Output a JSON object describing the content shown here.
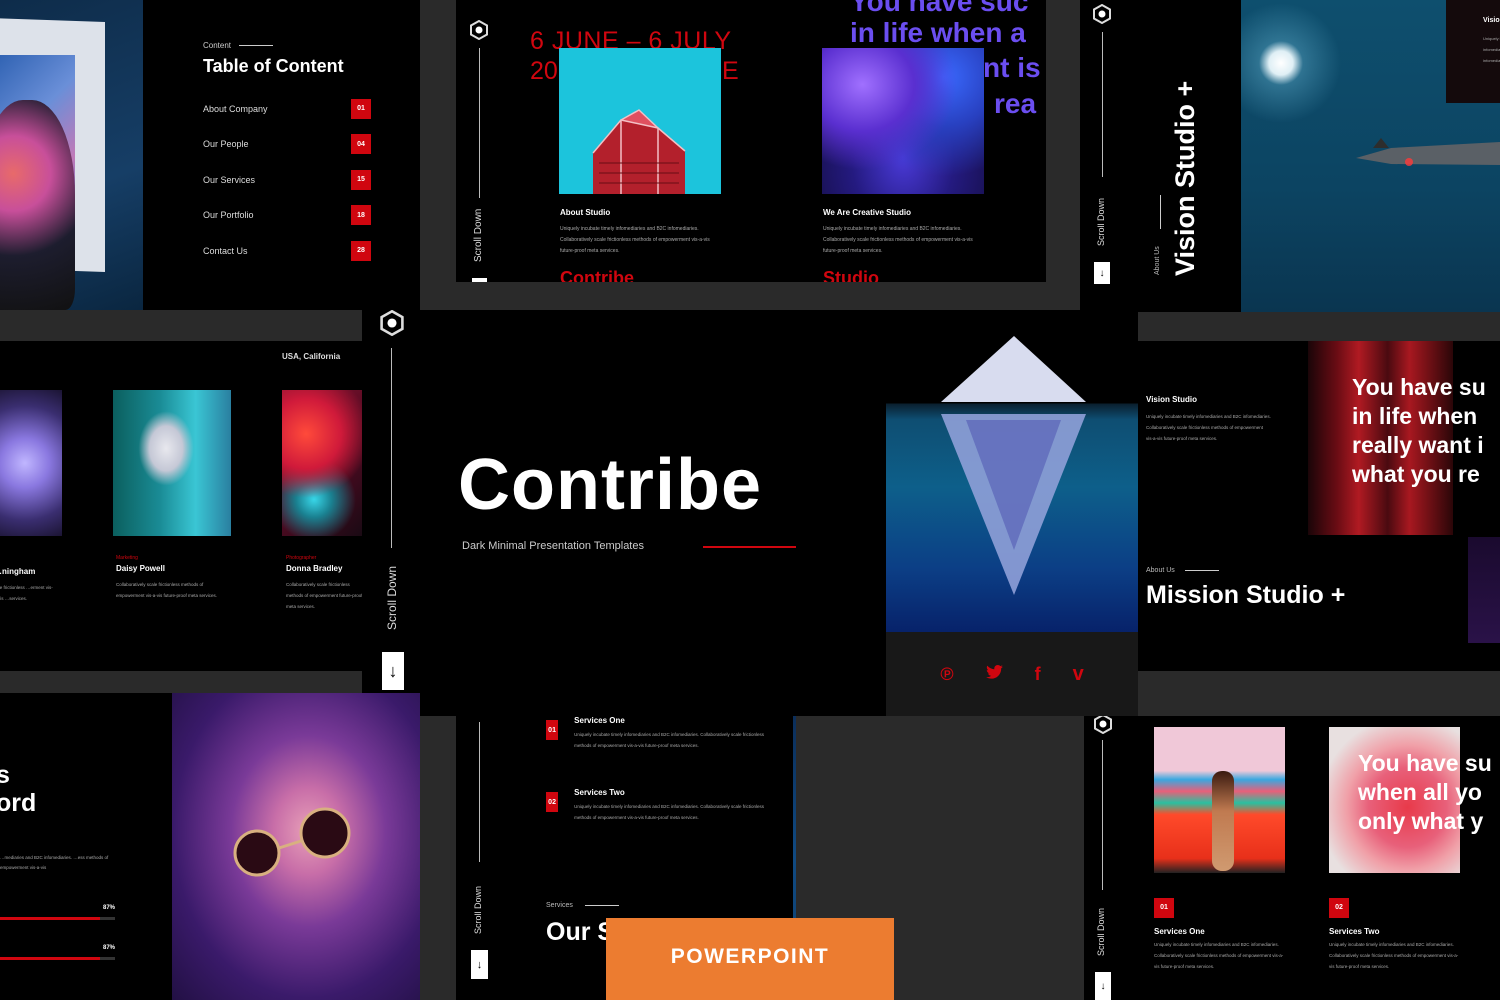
{
  "colors": {
    "background": "#2a2a2a",
    "slide_bg": "#000000",
    "accent_red": "#d0060f",
    "badge_orange": "#ec7c30",
    "purple_text": "#6b4ef0"
  },
  "slides": {
    "portrait_top_left": {
      "image": "woman-face-painted-portrait"
    },
    "table_of_content": {
      "eyebrow": "Content",
      "title": "Table of Content",
      "items": [
        {
          "label": "About Company",
          "page": "01"
        },
        {
          "label": "Our People",
          "page": "04"
        },
        {
          "label": "Our Services",
          "page": "15"
        },
        {
          "label": "Our Portfolio",
          "page": "18"
        },
        {
          "label": "Contact Us",
          "page": "28"
        }
      ]
    },
    "about_studio": {
      "scroll_label": "Scroll Down",
      "date_line1": "6 JUNE – 6 JULY",
      "date_line2_left": "20",
      "date_line2_right": "E",
      "heading": "About Studio",
      "body": "Uniquely incubate timely infomediaries and B2C infomediaries. Collaboratively scale frictionless methods of empowerment vis-a-vis future-proof meta services.",
      "footer_word": "Contribe"
    },
    "creative_studio": {
      "quote_lines": [
        "You have suc",
        "in life when a",
        "nt is",
        "rea"
      ],
      "heading": "We Are Creative Studio",
      "body": "Uniquely incubate timely infomediaries and B2C infomediaries. Collaboratively scale frictionless methods of empowerment vis-a-vis future-proof meta services.",
      "footer_word": "Studio"
    },
    "vision_studio": {
      "scroll_label": "Scroll Down",
      "eyebrow": "About Us",
      "title": "Vision Studio +",
      "card_title": "Vision",
      "card_body": "Uniquely incubate timely infomediaries and B2C infomediaries."
    },
    "team": {
      "location": "USA, California",
      "members": [
        {
          "name": "…ningham",
          "role": "",
          "body": "…te frictionless …erment vis-a-vis …services."
        },
        {
          "name": "Daisy Powell",
          "role": "Marketing",
          "body": "Collaboratively scale frictionless methods of empowerment vis-a-vis future-proof meta services."
        },
        {
          "name": "Donna Bradley",
          "role": "Photographer",
          "body": "Collaboratively scale frictionless methods of empowerment future-proof meta services."
        }
      ]
    },
    "cover": {
      "title": "Contribe",
      "subtitle": "Dark Minimal Presentation Templates",
      "scroll_label": "Scroll Down",
      "social": [
        {
          "name": "pinterest",
          "glyph": "𝓅"
        },
        {
          "name": "twitter",
          "glyph": "🐦"
        },
        {
          "name": "facebook",
          "glyph": "f"
        },
        {
          "name": "vimeo",
          "glyph": "v"
        }
      ]
    },
    "mission": {
      "card_title": "Vision Studio",
      "card_body": "Uniquely incubate timely infomediaries and B2C infomediaries. Collaboratively scale frictionless methods of empowerment vis-a-vis future-proof meta services.",
      "quote_lines": [
        "You have su",
        "in life when",
        "really want i",
        "what you re"
      ],
      "eyebrow": "About Us",
      "title": "Mission Studio +"
    },
    "skills": {
      "title_lines": [
        "s",
        "ord"
      ],
      "body": "…mediaries and B2C infomediaries. …ess methods of empowerment vis-a-vis",
      "bars": [
        {
          "label": "87%",
          "value": 87
        },
        {
          "label": "87%",
          "value": 87
        }
      ]
    },
    "services_list": {
      "scroll_label": "Scroll Down",
      "items": [
        {
          "num": "01",
          "title": "Services One",
          "body": "Uniquely incubate timely infomediaries and B2C infomediaries. Collaboratively scale frictionless methods of empowerment vis-a-vis future-proof meta services."
        },
        {
          "num": "02",
          "title": "Services Two",
          "body": "Uniquely incubate timely infomediaries and B2C infomediaries. Collaboratively scale frictionless methods of empowerment vis-a-vis future-proof meta services."
        }
      ],
      "eyebrow": "Services",
      "title": "Our S"
    },
    "services_cards": {
      "scroll_label": "Scroll Down",
      "cards": [
        {
          "num": "01",
          "title": "Services One",
          "body": "Uniquely incubate timely infomediaries and B2C infomediaries. Collaboratively scale frictionless methods of empowerment vis-a-vis future-proof meta services."
        },
        {
          "num": "02",
          "title": "Services Two",
          "body": "Uniquely incubate timely infomediaries and B2C infomediaries. Collaboratively scale frictionless methods of empowerment vis-a-vis future-proof meta services."
        }
      ],
      "overlay_lines": [
        "You have su",
        "when all yo",
        "only what y"
      ]
    }
  },
  "badge": {
    "label": "POWERPOINT"
  }
}
